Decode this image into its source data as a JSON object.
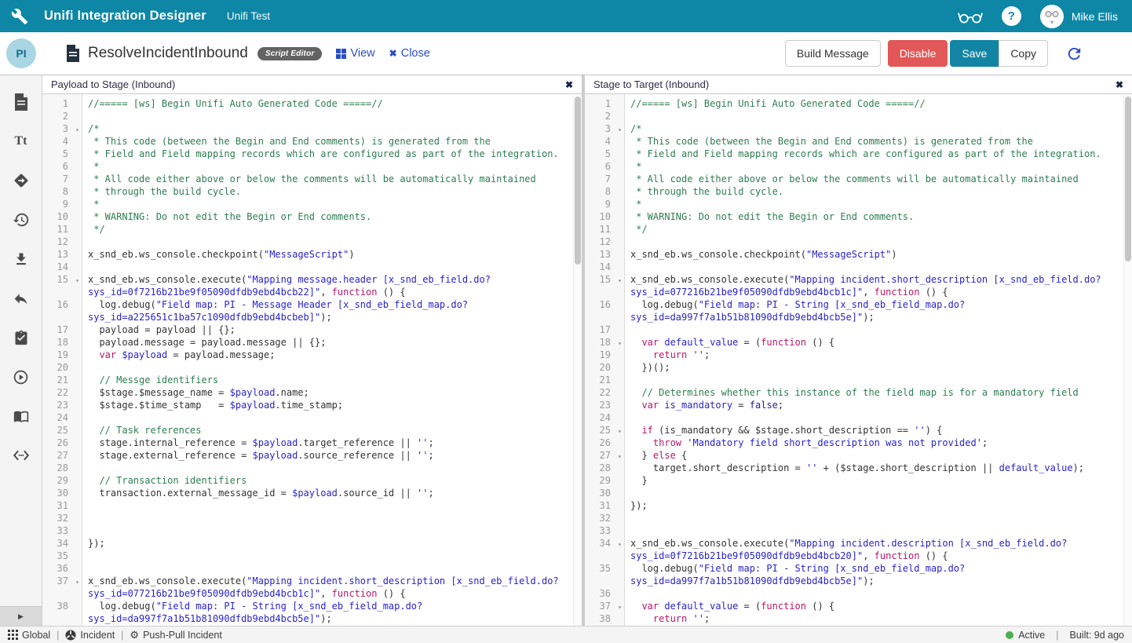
{
  "topbar": {
    "title": "Unifi Integration Designer",
    "subtitle": "Unifi Test",
    "user": "Mike Ellis",
    "help": "?"
  },
  "toolbar": {
    "avatar": "PI",
    "doc_title": "ResolveIncidentInbound",
    "badge": "Script Editor",
    "view_label": "View",
    "close_label": "Close",
    "build_label": "Build Message",
    "disable_label": "Disable",
    "save_label": "Save",
    "copy_label": "Copy"
  },
  "colors": {
    "brand_teal": "#0e87a6",
    "link_blue": "#2b4ec8",
    "danger_red": "#e25757",
    "active_green": "#4caf50"
  },
  "sidebar": {
    "icons": [
      "script-icon",
      "text-format-icon",
      "mapping-icon",
      "history-icon",
      "import-icon",
      "undo-icon",
      "tasks-icon",
      "run-icon",
      "docs-icon",
      "code-icon"
    ],
    "collapse": "▶"
  },
  "statusbar": {
    "items": [
      {
        "icon": "grid-icon",
        "label": "Global"
      },
      {
        "icon": "incident-icon",
        "label": "Incident"
      },
      {
        "icon": "gear-icon",
        "label": "Push-Pull Incident"
      }
    ],
    "active": "Active",
    "built": "Built: 9d ago"
  },
  "panels": [
    {
      "title": "Payload to Stage (Inbound)",
      "close": "✖",
      "lines": [
        [
          1,
          0,
          [
            [
              "c",
              "//===== [ws] Begin Unifi Auto Generated Code =====//"
            ]
          ]
        ],
        [
          2,
          0,
          []
        ],
        [
          3,
          1,
          [
            [
              "c",
              "/*"
            ]
          ]
        ],
        [
          4,
          0,
          [
            [
              "c",
              " * This code (between the Begin and End comments) is generated from the"
            ]
          ]
        ],
        [
          5,
          0,
          [
            [
              "c",
              " * Field and Field mapping records which are configured as part of the integration."
            ]
          ]
        ],
        [
          6,
          0,
          [
            [
              "c",
              " *"
            ]
          ]
        ],
        [
          7,
          0,
          [
            [
              "c",
              " * All code either above or below the comments will be automatically maintained"
            ]
          ]
        ],
        [
          8,
          0,
          [
            [
              "c",
              " * through the build cycle."
            ]
          ]
        ],
        [
          9,
          0,
          [
            [
              "c",
              " *"
            ]
          ]
        ],
        [
          10,
          0,
          [
            [
              "c",
              " * WARNING: Do not edit the Begin or End comments."
            ]
          ]
        ],
        [
          11,
          0,
          [
            [
              "c",
              " */"
            ]
          ]
        ],
        [
          12,
          0,
          []
        ],
        [
          13,
          0,
          [
            [
              "p",
              "x_snd_eb.ws_console.checkpoint("
            ],
            [
              "s",
              "\"MessageScript\""
            ],
            [
              "p",
              ")"
            ]
          ]
        ],
        [
          14,
          0,
          []
        ],
        [
          15,
          1,
          [
            [
              "p",
              "x_snd_eb.ws_console.execute("
            ],
            [
              "s",
              "\"Mapping message.header [x_snd_eb_field.do?sys_id=0f7216b21be9f05090dfdb9ebd4bcb22]\""
            ],
            [
              "p",
              ", "
            ],
            [
              "k",
              "function"
            ],
            [
              "p",
              " () {"
            ]
          ]
        ],
        [
          16,
          0,
          [
            [
              "p",
              "  log.debug("
            ],
            [
              "s",
              "\"Field map: PI - Message Header [x_snd_eb_field_map.do?sys_id=a225651c1ba57c1090dfdb9ebd4bcbeb]\""
            ],
            [
              "p",
              ");"
            ]
          ]
        ],
        [
          17,
          0,
          [
            [
              "p",
              "  payload = payload || {};"
            ]
          ]
        ],
        [
          18,
          0,
          [
            [
              "p",
              "  payload.message = payload.message || {};"
            ]
          ]
        ],
        [
          19,
          0,
          [
            [
              "p",
              "  "
            ],
            [
              "k",
              "var"
            ],
            [
              "p",
              " "
            ],
            [
              "v",
              "$payload"
            ],
            [
              "p",
              " = payload.message;"
            ]
          ]
        ],
        [
          20,
          0,
          []
        ],
        [
          21,
          0,
          [
            [
              "c",
              "  // Messge identifiers"
            ]
          ]
        ],
        [
          22,
          0,
          [
            [
              "p",
              "  $stage.$message_name = "
            ],
            [
              "v",
              "$payload"
            ],
            [
              "p",
              ".name;"
            ]
          ]
        ],
        [
          23,
          0,
          [
            [
              "p",
              "  $stage.$time_stamp   = "
            ],
            [
              "v",
              "$payload"
            ],
            [
              "p",
              ".time_stamp;"
            ]
          ]
        ],
        [
          24,
          0,
          []
        ],
        [
          25,
          0,
          [
            [
              "c",
              "  // Task references"
            ]
          ]
        ],
        [
          26,
          0,
          [
            [
              "p",
              "  stage.internal_reference = "
            ],
            [
              "v",
              "$payload"
            ],
            [
              "p",
              ".target_reference || "
            ],
            [
              "s",
              "''"
            ],
            [
              "p",
              ";"
            ]
          ]
        ],
        [
          27,
          0,
          [
            [
              "p",
              "  stage.external_reference = "
            ],
            [
              "v",
              "$payload"
            ],
            [
              "p",
              ".source_reference || "
            ],
            [
              "s",
              "''"
            ],
            [
              "p",
              ";"
            ]
          ]
        ],
        [
          28,
          0,
          []
        ],
        [
          29,
          0,
          [
            [
              "c",
              "  // Transaction identifiers"
            ]
          ]
        ],
        [
          30,
          0,
          [
            [
              "p",
              "  transaction.external_message_id = "
            ],
            [
              "v",
              "$payload"
            ],
            [
              "p",
              ".source_id || "
            ],
            [
              "s",
              "''"
            ],
            [
              "p",
              ";"
            ]
          ]
        ],
        [
          31,
          0,
          []
        ],
        [
          32,
          0,
          []
        ],
        [
          33,
          0,
          []
        ],
        [
          34,
          0,
          [
            [
              "p",
              "});"
            ]
          ]
        ],
        [
          35,
          0,
          []
        ],
        [
          36,
          0,
          []
        ],
        [
          37,
          1,
          [
            [
              "p",
              "x_snd_eb.ws_console.execute("
            ],
            [
              "s",
              "\"Mapping incident.short_description [x_snd_eb_field.do?sys_id=077216b21be9f05090dfdb9ebd4bcb1c]\""
            ],
            [
              "p",
              ", "
            ],
            [
              "k",
              "function"
            ],
            [
              "p",
              " () {"
            ]
          ]
        ],
        [
          38,
          0,
          [
            [
              "p",
              "  log.debug("
            ],
            [
              "s",
              "\"Field map: PI - String [x_snd_eb_field_map.do?sys_id=da997f7a1b51b81090dfdb9ebd4bcb5e]\""
            ],
            [
              "p",
              ");"
            ]
          ]
        ]
      ]
    },
    {
      "title": "Stage to Target (Inbound)",
      "close": "✖",
      "lines": [
        [
          1,
          0,
          [
            [
              "c",
              "//===== [ws] Begin Unifi Auto Generated Code =====//"
            ]
          ]
        ],
        [
          2,
          0,
          []
        ],
        [
          3,
          1,
          [
            [
              "c",
              "/*"
            ]
          ]
        ],
        [
          4,
          0,
          [
            [
              "c",
              " * This code (between the Begin and End comments) is generated from the"
            ]
          ]
        ],
        [
          5,
          0,
          [
            [
              "c",
              " * Field and Field mapping records which are configured as part of the integration."
            ]
          ]
        ],
        [
          6,
          0,
          [
            [
              "c",
              " *"
            ]
          ]
        ],
        [
          7,
          0,
          [
            [
              "c",
              " * All code either above or below the comments will be automatically maintained"
            ]
          ]
        ],
        [
          8,
          0,
          [
            [
              "c",
              " * through the build cycle."
            ]
          ]
        ],
        [
          9,
          0,
          [
            [
              "c",
              " *"
            ]
          ]
        ],
        [
          10,
          0,
          [
            [
              "c",
              " * WARNING: Do not edit the Begin or End comments."
            ]
          ]
        ],
        [
          11,
          0,
          [
            [
              "c",
              " */"
            ]
          ]
        ],
        [
          12,
          0,
          []
        ],
        [
          13,
          0,
          [
            [
              "p",
              "x_snd_eb.ws_console.checkpoint("
            ],
            [
              "s",
              "\"MessageScript\""
            ],
            [
              "p",
              ")"
            ]
          ]
        ],
        [
          14,
          0,
          []
        ],
        [
          15,
          1,
          [
            [
              "p",
              "x_snd_eb.ws_console.execute("
            ],
            [
              "s",
              "\"Mapping incident.short_description [x_snd_eb_field.do?sys_id=077216b21be9f05090dfdb9ebd4bcb1c]\""
            ],
            [
              "p",
              ", "
            ],
            [
              "k",
              "function"
            ],
            [
              "p",
              " () {"
            ]
          ]
        ],
        [
          16,
          0,
          [
            [
              "p",
              "  log.debug("
            ],
            [
              "s",
              "\"Field map: PI - String [x_snd_eb_field_map.do?sys_id=da997f7a1b51b81090dfdb9ebd4bcb5e]\""
            ],
            [
              "p",
              ");"
            ]
          ]
        ],
        [
          17,
          0,
          []
        ],
        [
          18,
          1,
          [
            [
              "p",
              "  "
            ],
            [
              "k",
              "var"
            ],
            [
              "p",
              " "
            ],
            [
              "v",
              "default_value"
            ],
            [
              "p",
              " = ("
            ],
            [
              "k",
              "function"
            ],
            [
              "p",
              " () {"
            ]
          ]
        ],
        [
          19,
          0,
          [
            [
              "p",
              "    "
            ],
            [
              "k",
              "return"
            ],
            [
              "p",
              " "
            ],
            [
              "s",
              "''"
            ],
            [
              "p",
              ";"
            ]
          ]
        ],
        [
          20,
          0,
          [
            [
              "p",
              "  })();"
            ]
          ]
        ],
        [
          21,
          0,
          []
        ],
        [
          22,
          0,
          [
            [
              "c",
              "  // Determines whether this instance of the field map is for a mandatory field"
            ]
          ]
        ],
        [
          23,
          0,
          [
            [
              "p",
              "  "
            ],
            [
              "k",
              "var"
            ],
            [
              "p",
              " "
            ],
            [
              "v",
              "is_mandatory"
            ],
            [
              "p",
              " = "
            ],
            [
              "a",
              "false"
            ],
            [
              "p",
              ";"
            ]
          ]
        ],
        [
          24,
          0,
          []
        ],
        [
          25,
          1,
          [
            [
              "p",
              "  "
            ],
            [
              "k",
              "if"
            ],
            [
              "p",
              " (is_mandatory && $stage.short_description == "
            ],
            [
              "s",
              "''"
            ],
            [
              "p",
              ") {"
            ]
          ]
        ],
        [
          26,
          0,
          [
            [
              "p",
              "    "
            ],
            [
              "k",
              "throw"
            ],
            [
              "p",
              " "
            ],
            [
              "s",
              "'Mandatory field short_description was not provided'"
            ],
            [
              "p",
              ";"
            ]
          ]
        ],
        [
          27,
          1,
          [
            [
              "p",
              "  } "
            ],
            [
              "k",
              "else"
            ],
            [
              "p",
              " {"
            ]
          ]
        ],
        [
          28,
          0,
          [
            [
              "p",
              "    target.short_description = "
            ],
            [
              "s",
              "''"
            ],
            [
              "p",
              " + ($stage.short_description || "
            ],
            [
              "v",
              "default_value"
            ],
            [
              "p",
              ");"
            ]
          ]
        ],
        [
          29,
          0,
          [
            [
              "p",
              "  }"
            ]
          ]
        ],
        [
          30,
          0,
          []
        ],
        [
          31,
          0,
          [
            [
              "p",
              "});"
            ]
          ]
        ],
        [
          32,
          0,
          []
        ],
        [
          33,
          0,
          []
        ],
        [
          34,
          1,
          [
            [
              "p",
              "x_snd_eb.ws_console.execute("
            ],
            [
              "s",
              "\"Mapping incident.description [x_snd_eb_field.do?sys_id=0f7216b21be9f05090dfdb9ebd4bcb20]\""
            ],
            [
              "p",
              ", "
            ],
            [
              "k",
              "function"
            ],
            [
              "p",
              " () {"
            ]
          ]
        ],
        [
          35,
          0,
          [
            [
              "p",
              "  log.debug("
            ],
            [
              "s",
              "\"Field map: PI - String [x_snd_eb_field_map.do?sys_id=da997f7a1b51b81090dfdb9ebd4bcb5e]\""
            ],
            [
              "p",
              ");"
            ]
          ]
        ],
        [
          36,
          0,
          []
        ],
        [
          37,
          1,
          [
            [
              "p",
              "  "
            ],
            [
              "k",
              "var"
            ],
            [
              "p",
              " "
            ],
            [
              "v",
              "default_value"
            ],
            [
              "p",
              " = ("
            ],
            [
              "k",
              "function"
            ],
            [
              "p",
              " () {"
            ]
          ]
        ],
        [
          38,
          0,
          [
            [
              "p",
              "    "
            ],
            [
              "k",
              "return"
            ],
            [
              "p",
              " "
            ],
            [
              "s",
              "''"
            ],
            [
              "p",
              ";"
            ]
          ]
        ]
      ]
    }
  ]
}
